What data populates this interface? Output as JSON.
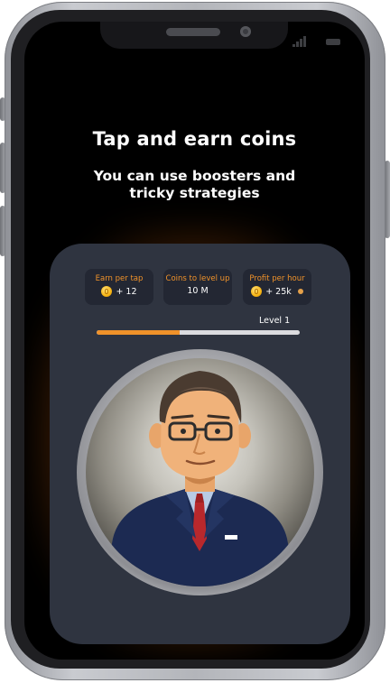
{
  "hero": {
    "title": "Tap and earn coins",
    "subtitle_line1": "You can use boosters and",
    "subtitle_line2": "tricky strategies"
  },
  "stats": [
    {
      "label": "Earn per tap",
      "value": "+ 12",
      "icon": "coin-icon"
    },
    {
      "label": "Coins to level up",
      "value": "10 M"
    },
    {
      "label": "Profit per hour",
      "value": "+ 25k",
      "icon": "coin-icon",
      "extra_icon": "info-icon"
    }
  ],
  "level": {
    "label": "Level 1",
    "progress_fraction": 0.41
  },
  "colors": {
    "accent": "#f0922a",
    "card_bg": "#2f3440",
    "stat_bg": "#232733",
    "screen_bg": "#000000",
    "glow": "#d17314"
  },
  "avatar": {
    "icon": "businessman-avatar"
  }
}
